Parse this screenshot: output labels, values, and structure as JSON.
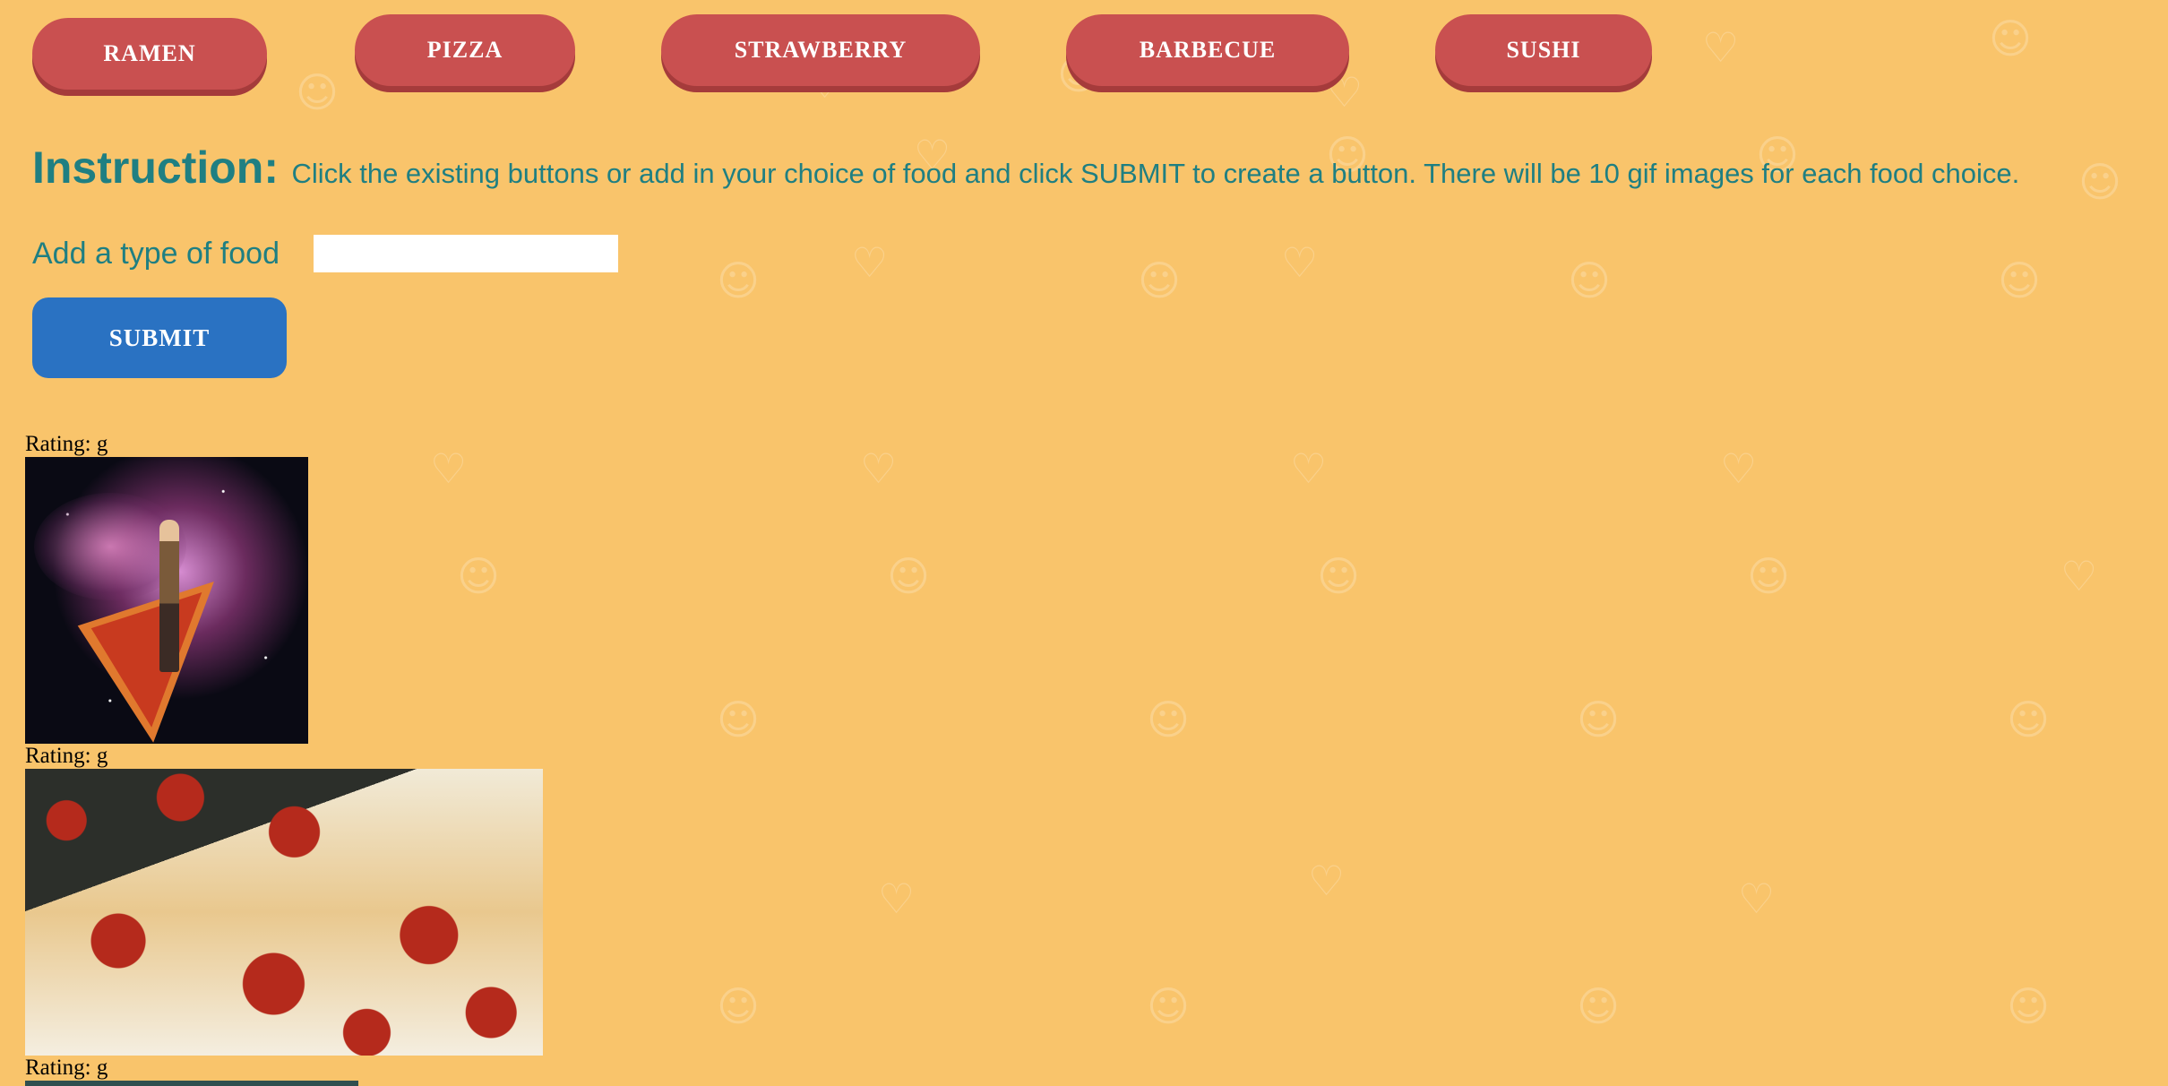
{
  "topics": {
    "buttons": [
      {
        "label": "RAMEN"
      },
      {
        "label": "PIZZA"
      },
      {
        "label": "STRAWBERRY"
      },
      {
        "label": "BARBECUE"
      },
      {
        "label": "SUSHI"
      }
    ]
  },
  "instruction": {
    "label": "Instruction:",
    "text": "Click the existing buttons or add in your choice of food and click SUBMIT to create a button. There will be 10 gif images for each food choice."
  },
  "form": {
    "add_label": "Add a type of food",
    "input_value": "",
    "submit_label": "SUBMIT"
  },
  "gifs": [
    {
      "rating": "Rating: g",
      "image": "pizza-space-cowboy-gif"
    },
    {
      "rating": "Rating: g",
      "image": "cheesy-pepperoni-pizza-gif"
    },
    {
      "rating": "Rating: g",
      "image": "gif-partially-visible"
    }
  ],
  "colors": {
    "background": "#f9c46b",
    "topic_button": "#c95050",
    "submit_button": "#2a72c2",
    "instruction_text": "#1f7f82"
  }
}
